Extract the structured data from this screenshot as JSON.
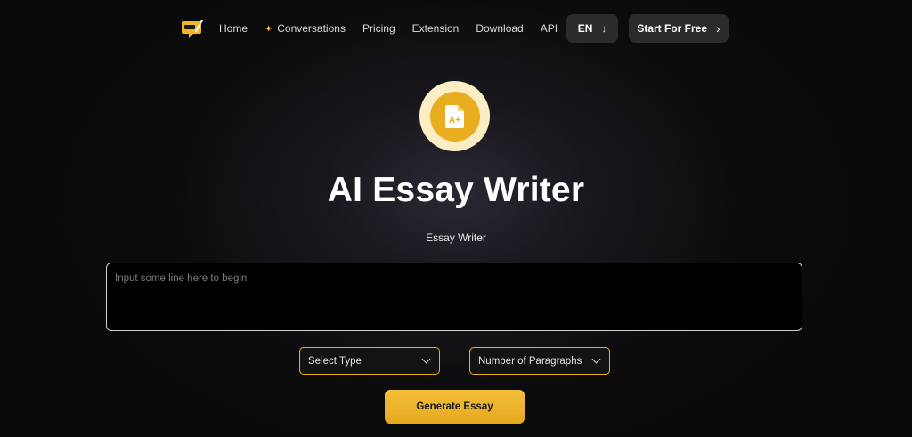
{
  "nav": {
    "logo_icon": "chat-bubble-logo-icon",
    "links": [
      {
        "label": "Home"
      },
      {
        "label": "Conversations",
        "icon": "sparkle-icon"
      },
      {
        "label": "Pricing"
      },
      {
        "label": "Extension"
      },
      {
        "label": "Download"
      },
      {
        "label": "API"
      }
    ],
    "lang_label": "EN",
    "lang_arrow": "↓",
    "start_label": "Start For Free",
    "start_chevron": "›"
  },
  "hero": {
    "icon": "document-grade-a-plus-icon",
    "title": "AI Essay Writer",
    "subtitle": "Essay Writer"
  },
  "form": {
    "input_placeholder": "Input some line here to begin",
    "input_value": "",
    "type_select_label": "Select Type",
    "paragraphs_select_label": "Number of Paragraphs",
    "generate_label": "Generate Essay"
  },
  "colors": {
    "accent": "#e9ad20",
    "accent_light": "#fbeec4",
    "background": "#0a0a0b",
    "button_dark": "#2b2b2e"
  }
}
